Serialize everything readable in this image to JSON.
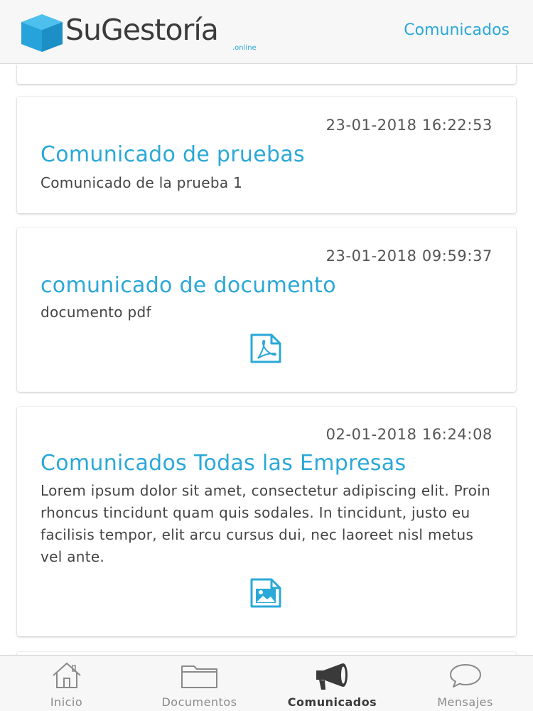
{
  "header": {
    "logo_text": "SuGestoría",
    "logo_sub": ".online",
    "title": "Comunicados"
  },
  "colors": {
    "accent": "#2aa8d8",
    "text": "#444444",
    "inactive_tab": "#8a8a8a",
    "active_tab": "#3a3a3a"
  },
  "comunicados": [
    {
      "date": "23-01-2018 16:22:53",
      "title": "Comunicado de pruebas",
      "body": "Comunicado de la prueba 1",
      "attachment": null
    },
    {
      "date": "23-01-2018 09:59:37",
      "title": "comunicado de documento",
      "body": "documento pdf",
      "attachment": "pdf-file-icon"
    },
    {
      "date": "02-01-2018 16:24:08",
      "title": "Comunicados Todas las Empresas",
      "body": "Lorem ipsum dolor sit amet, consectetur adipiscing elit. Proin rhoncus tincidunt quam quis sodales. In tincidunt, justo eu facilisis tempor, elit arcu cursus dui, nec laoreet nisl metus vel ante.",
      "attachment": "image-file-icon"
    }
  ],
  "tabbar": {
    "tabs": [
      {
        "label": "Inicio",
        "icon": "home-icon",
        "active": false
      },
      {
        "label": "Documentos",
        "icon": "folder-icon",
        "active": false
      },
      {
        "label": "Comunicados",
        "icon": "megaphone-icon",
        "active": true
      },
      {
        "label": "Mensajes",
        "icon": "chat-bubble-icon",
        "active": false
      }
    ]
  }
}
